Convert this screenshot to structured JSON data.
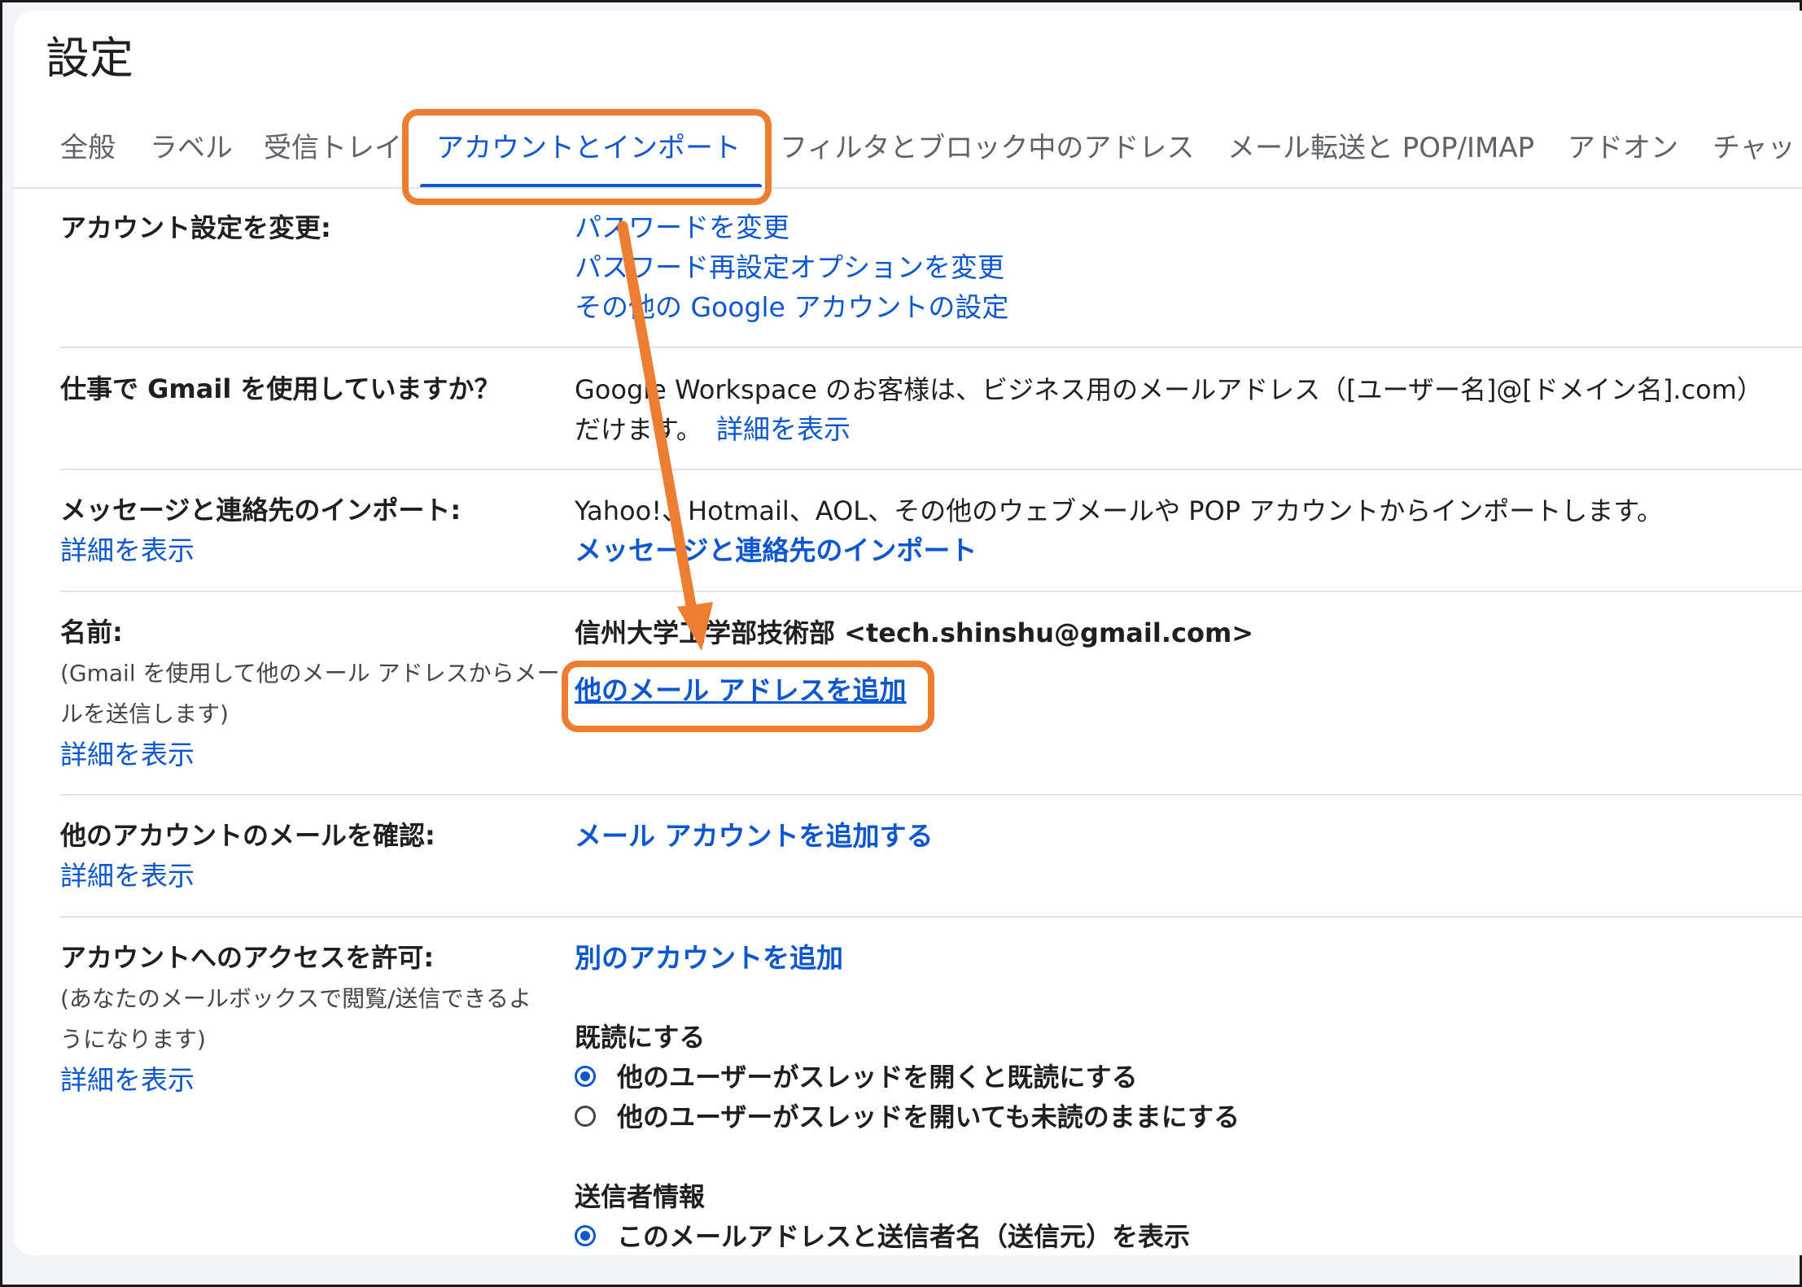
{
  "page_title": "設定",
  "tabs": [
    {
      "label": "全般"
    },
    {
      "label": "ラベル"
    },
    {
      "label": "受信トレイ"
    },
    {
      "label": "アカウントとインポート",
      "active": true
    },
    {
      "label": "フィルタとブロック中のアドレス"
    },
    {
      "label": "メール転送と POP/IMAP"
    },
    {
      "label": "アドオン"
    },
    {
      "label": "チャッ"
    }
  ],
  "sections": {
    "account_settings": {
      "label": "アカウント設定を変更:",
      "links": [
        "パスワードを変更",
        "パスワード再設定オプションを変更",
        "その他の Google アカウントの設定"
      ]
    },
    "work": {
      "label": "仕事で Gmail を使用していますか？",
      "line1": "Google Workspace のお客様は、ビジネス用のメールアドレス（[ユーザー名]@[ドメイン名].com）",
      "line2": "だけます。",
      "details": "詳細を表示"
    },
    "import": {
      "label": "メッセージと連絡先のインポート:",
      "details": "詳細を表示",
      "text": "Yahoo!、Hotmail、AOL、その他のウェブメールや POP アカウントからインポートします。",
      "link": "メッセージと連絡先のインポート"
    },
    "name": {
      "label": "名前:",
      "sub1": "(Gmail を使用して他のメール アドレスからメー",
      "sub2": "ルを送信します)",
      "details": "詳細を表示",
      "value": "信州大学工学部技術部 <tech.shinshu@gmail.com>",
      "add_link": "他のメール アドレスを追加"
    },
    "check_mail": {
      "label": "他のアカウントのメールを確認:",
      "details": "詳細を表示",
      "link": "メール アカウントを追加する"
    },
    "grant_access": {
      "label": "アカウントへのアクセスを許可:",
      "sub1": "(あなたのメールボックスで閲覧/送信できるよ",
      "sub2": "うになります)",
      "details": "詳細を表示",
      "link": "別のアカウントを追加",
      "read_heading": "既読にする",
      "read_options": [
        {
          "label": "他のユーザーがスレッドを開くと既読にする",
          "checked": true
        },
        {
          "label": "他のユーザーがスレッドを開いても未読のままにする",
          "checked": false
        }
      ],
      "sender_heading": "送信者情報",
      "sender_options": [
        {
          "label": "このメールアドレスと送信者名（送信元）を表示",
          "checked": true
        }
      ]
    }
  },
  "colors": {
    "accent": "#0b57d0",
    "highlight": "#ed7d31"
  },
  "icons": [
    "radio-checked-icon",
    "radio-unchecked-icon",
    "annotation-arrow-icon"
  ]
}
